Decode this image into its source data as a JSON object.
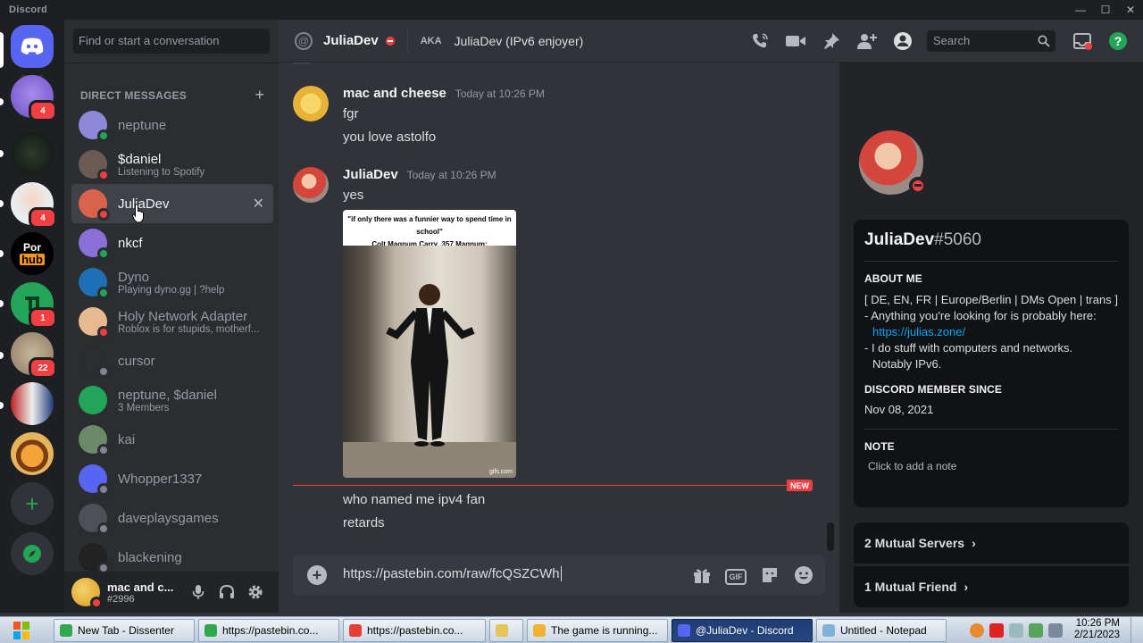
{
  "window": {
    "title": "Discord",
    "controls": [
      "—",
      "☐",
      "✕"
    ]
  },
  "rail": {
    "servers": [
      {
        "id": "home",
        "badge": null
      },
      {
        "id": "server-purple",
        "badge": "4"
      },
      {
        "id": "server-dark",
        "badge": null
      },
      {
        "id": "server-peter",
        "badge": "4"
      },
      {
        "id": "server-hub",
        "badge": null,
        "text": "hub"
      },
      {
        "id": "server-green",
        "badge": "1"
      },
      {
        "id": "server-cat",
        "badge": "22"
      },
      {
        "id": "server-man",
        "badge": null
      },
      {
        "id": "server-burger",
        "badge": null
      }
    ],
    "hub_top": "Por"
  },
  "dms": {
    "search_placeholder": "Find or start a conversation",
    "header": "DIRECT MESSAGES",
    "items": [
      {
        "name": "neptune",
        "sub": "",
        "status": "online",
        "bright": false,
        "color": "#8f88d8"
      },
      {
        "name": "$daniel",
        "sub": "Listening to Spotify",
        "status": "dnd",
        "bright": true,
        "color": "#6b5a52"
      },
      {
        "name": "JuliaDev",
        "sub": "",
        "status": "dnd",
        "bright": true,
        "color": "#d9624d"
      },
      {
        "name": "nkcf",
        "sub": "",
        "status": "online",
        "bright": true,
        "color": "#8a6fd6"
      },
      {
        "name": "Dyno",
        "sub": "Playing dyno.gg | ?help",
        "status": "online",
        "bright": false,
        "color": "#1f6fb5"
      },
      {
        "name": "Holy Network Adapter",
        "sub": "Roblox is for stupids, motherf...",
        "status": "dnd",
        "bright": false,
        "color": "#e8b98f"
      },
      {
        "name": "cursor",
        "sub": "",
        "status": "offline",
        "bright": false,
        "color": "#2b2d31"
      },
      {
        "name": "neptune, $daniel",
        "sub": "3 Members",
        "status": "none",
        "bright": false,
        "color": "#23a559"
      },
      {
        "name": "kai",
        "sub": "",
        "status": "offline",
        "bright": false,
        "color": "#6a8a6a"
      },
      {
        "name": "Whopper1337",
        "sub": "",
        "status": "offline",
        "bright": false,
        "color": "#5865f2"
      },
      {
        "name": "daveplaysgames",
        "sub": "",
        "status": "offline",
        "bright": false,
        "color": "#4e5058"
      },
      {
        "name": "blackening",
        "sub": "",
        "status": "offline",
        "bright": false,
        "color": "#222"
      }
    ]
  },
  "user": {
    "name": "mac and c...",
    "tag": "#2996"
  },
  "header": {
    "name": "JuliaDev",
    "aka_label": "AKA",
    "aka_value": "JuliaDev (IPv6 enjoyer)",
    "search_placeholder": "Search"
  },
  "messages": [
    {
      "author": "mac and cheese",
      "time": "Today at 10:26 PM",
      "lines": [
        "fgr",
        "you love astolfo"
      ]
    },
    {
      "author": "JuliaDev",
      "time": "Today at 10:26 PM",
      "lines": [
        "yes"
      ]
    }
  ],
  "meme": {
    "caption1": "\"if only there was a funnier way to spend time in school\"",
    "caption2": "Colt Magnum Carry .357 Magnum:",
    "watermark": "gifs.com"
  },
  "new_label": "NEW",
  "after_new": [
    "who named me ipv4 fan",
    "retards"
  ],
  "composer": {
    "value": "https://pastebin.com/raw/fcQSZCWh",
    "gif": "GIF"
  },
  "profile": {
    "name": "JuliaDev",
    "discriminator": "#5060",
    "about_label": "ABOUT ME",
    "bio1": "[ DE, EN, FR | Europe/Berlin | DMs Open | trans ]",
    "bio2": "- Anything you're looking for is probably here:",
    "bio_link": "https://julias.zone/",
    "bio3": "- I do stuff with computers and networks.",
    "bio4": "Notably IPv6.",
    "member_label": "DISCORD MEMBER SINCE",
    "member_since": "Nov 08, 2021",
    "note_label": "NOTE",
    "note_placeholder": "Click to add a note",
    "mutual_servers": "2 Mutual Servers",
    "mutual_friends": "1 Mutual Friend"
  },
  "taskbar": {
    "tasks": [
      {
        "label": "New Tab - Dissenter",
        "active": false,
        "icon": "#2fa84f"
      },
      {
        "label": "https://pastebin.co...",
        "active": false,
        "icon": "#2fa84f"
      },
      {
        "label": "https://pastebin.co...",
        "active": false,
        "icon": "#e34133"
      },
      {
        "label": "",
        "active": false,
        "icon": "#e8c35a"
      },
      {
        "label": "The game is running...",
        "active": false,
        "icon": "#f0b232"
      },
      {
        "label": "@JuliaDev - Discord",
        "active": true,
        "icon": "#5865f2"
      },
      {
        "label": "Untitled - Notepad",
        "active": false,
        "icon": "#7fb3d8"
      }
    ],
    "time": "10:26 PM",
    "date": "2/21/2023"
  }
}
